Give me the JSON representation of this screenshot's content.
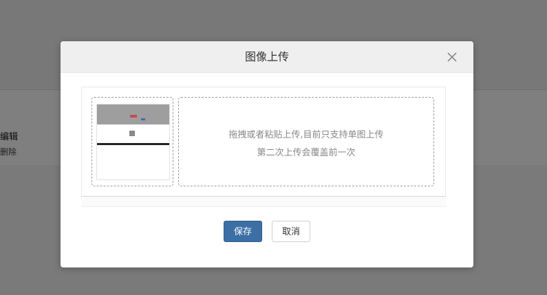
{
  "background": {
    "text_1": "编辑",
    "text_2": "删除"
  },
  "modal": {
    "title": "图像上传",
    "close_icon": "close-icon",
    "dropzone": {
      "line1": "拖拽或者粘贴上传,目前只支持单图上传",
      "line2": "第二次上传会覆盖前一次"
    },
    "buttons": {
      "save_label": "保存",
      "cancel_label": "取消"
    },
    "colors": {
      "primary": "#3c6fa6",
      "header_bg": "#efefef"
    }
  }
}
